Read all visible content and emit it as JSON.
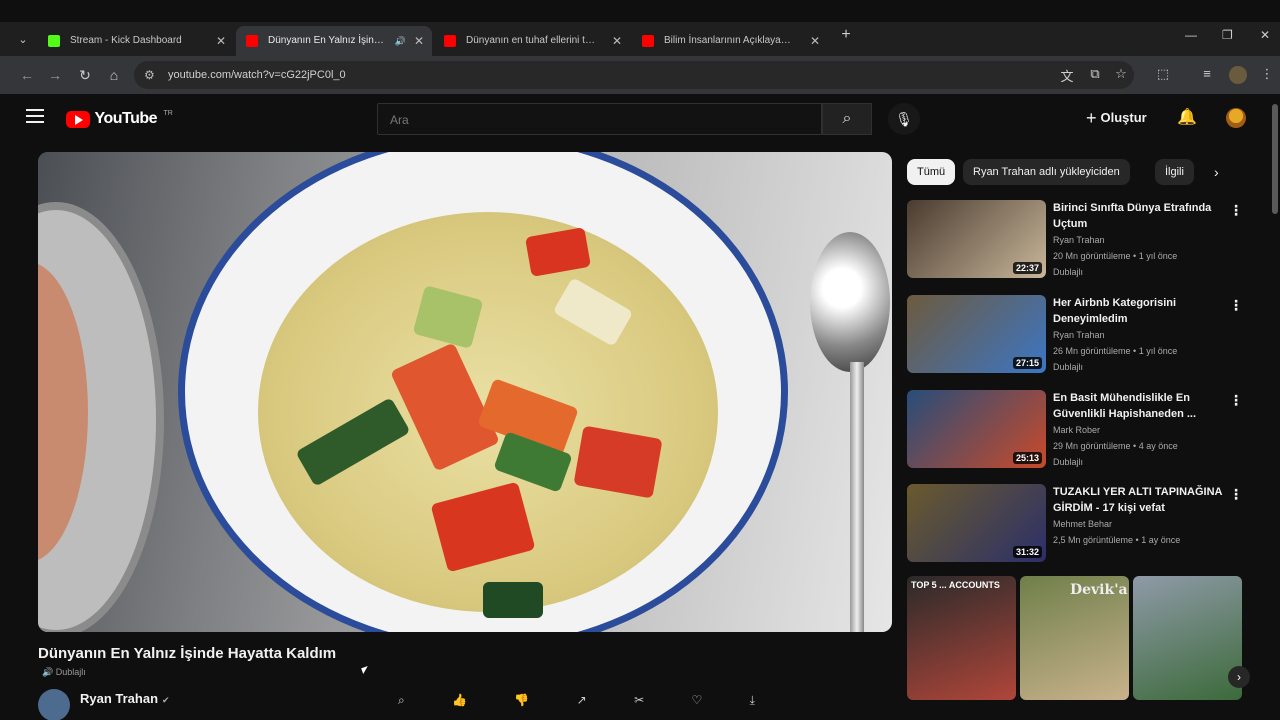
{
  "browser": {
    "tabs": [
      {
        "title": "Stream - Kick Dashboard",
        "favicon_color": "#53fc18",
        "active": false
      },
      {
        "title": "Dünyanın En Yalnız İşinde Hayatta Kaldım",
        "favicon_color": "#ff0000",
        "active": true,
        "audio": true
      },
      {
        "title": "Dünyanın en tuhaf ellerini test ettim",
        "favicon_color": "#ff0000",
        "active": false
      },
      {
        "title": "Bilim İnsanlarının Açıklayamadığı",
        "favicon_color": "#ff0000",
        "active": false
      }
    ],
    "url": "youtube.com/watch?v=cG22jPC0l_0"
  },
  "header": {
    "logo_text": "YouTube",
    "logo_cc": "TR",
    "search_placeholder": "Ara",
    "create_label": "Oluştur"
  },
  "video": {
    "title": "Dünyanın En Yalnız İşinde Hayatta Kaldım",
    "dub_label": "Dublajlı",
    "channel": "Ryan Trahan"
  },
  "sidebar": {
    "chips": [
      "Tümü",
      "Ryan Trahan adlı yükleyiciden",
      "İlgili"
    ],
    "recommendations": [
      {
        "title": "Birinci Sınıfta Dünya Etrafında Uçtum",
        "channel": "Ryan Trahan",
        "meta": "20 Mn görüntüleme • 1 yıl önce",
        "badge": "Dublajlı",
        "duration": "22:37",
        "thumb_colors": [
          "#4a3b30",
          "#c8b79a"
        ]
      },
      {
        "title": "Her Airbnb Kategorisini Deneyimledim",
        "channel": "Ryan Trahan",
        "meta": "26 Mn görüntüleme • 1 yıl önce",
        "badge": "Dublajlı",
        "duration": "27:15",
        "thumb_colors": [
          "#6d5a3e",
          "#3c76c4"
        ]
      },
      {
        "title": "En Basit Mühendislikle En Güvenlikli Hapishaneden ...",
        "channel": "Mark Rober",
        "meta": "29 Mn görüntüleme • 4 ay önce",
        "badge": "Dublajlı",
        "duration": "25:13",
        "thumb_colors": [
          "#274d7a",
          "#c94a2a"
        ]
      },
      {
        "title": "TUZAKLI YER ALTI TAPINAĞINA GİRDİM - 17 kişi vefat",
        "channel": "Mehmet Behar",
        "meta": "2,5 Mn görüntüleme • 1 ay önce",
        "badge": "",
        "duration": "31:32",
        "thumb_colors": [
          "#6a5a2c",
          "#2b2f6a"
        ]
      }
    ],
    "shorts": [
      {
        "label": "TOP 5 ... ACCOUNTS",
        "colors": [
          "#2a2a2a",
          "#b0463a"
        ]
      },
      {
        "label": "Devik'a",
        "colors": [
          "#6f7f4a",
          "#c9b28c"
        ]
      },
      {
        "label": "",
        "colors": [
          "#8f9aa8",
          "#3c6a3a"
        ]
      }
    ]
  }
}
